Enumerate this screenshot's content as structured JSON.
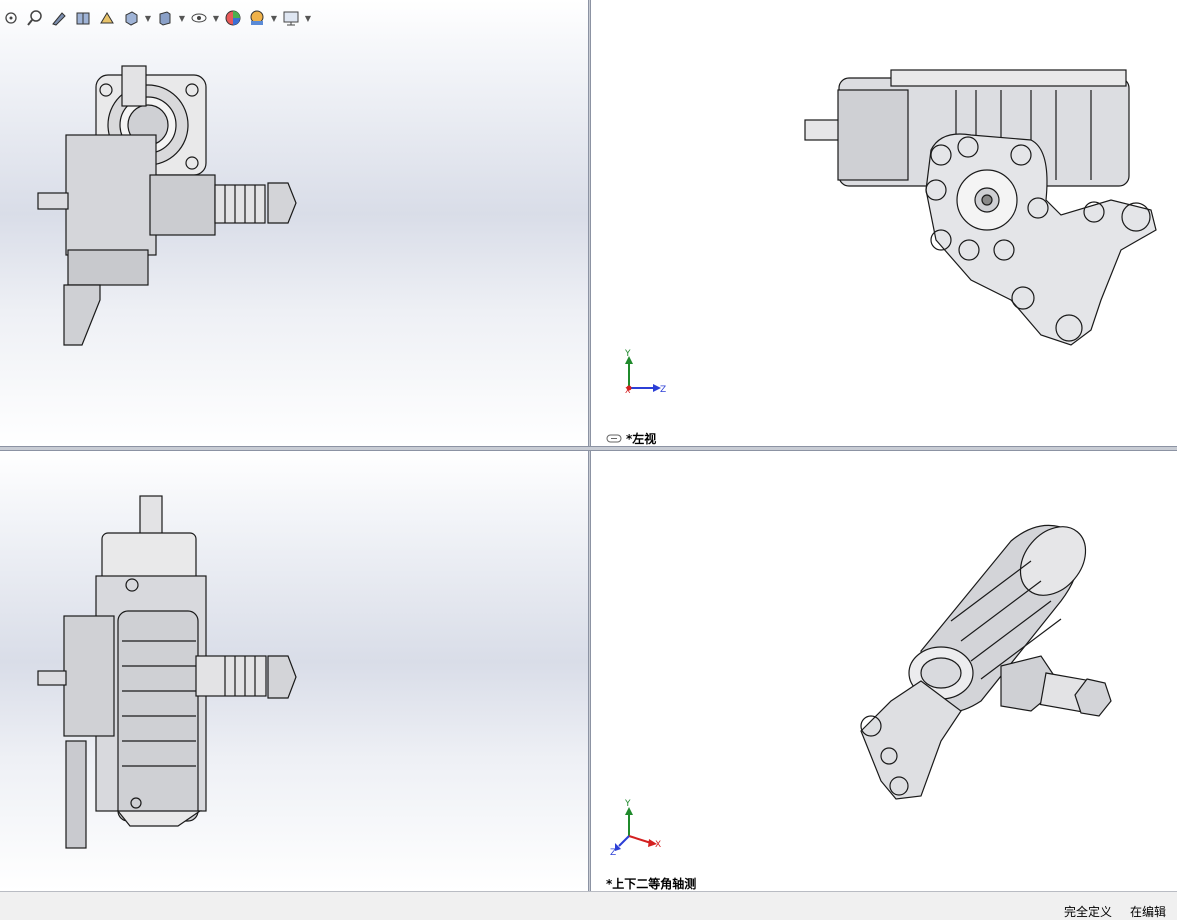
{
  "toolbar": {
    "items": [
      {
        "icon": "zoom-to-fit-icon"
      },
      {
        "icon": "zoom-area-icon"
      },
      {
        "icon": "previous-view-icon"
      },
      {
        "icon": "section-view-icon"
      },
      {
        "icon": "dynamic-annotation-icon"
      },
      {
        "icon": "view-orientation-icon",
        "dropdown": true
      },
      {
        "icon": "display-style-icon",
        "dropdown": true
      },
      {
        "icon": "hide-show-items-icon",
        "dropdown": true
      },
      {
        "icon": "edit-appearance-icon"
      },
      {
        "icon": "apply-scene-icon",
        "dropdown": true
      },
      {
        "icon": "view-settings-icon",
        "dropdown": true
      }
    ]
  },
  "viewports": {
    "top_right": {
      "label": "*左视",
      "link_icon": "link-views-icon"
    },
    "bottom_right": {
      "label": "*上下二等角轴测"
    }
  },
  "triad": {
    "y_label": "Y",
    "z_label": "Z",
    "x_label": "X"
  },
  "status": {
    "definition": "完全定义",
    "editing": "在编辑"
  },
  "colors": {
    "axis_y": "#1f8a2b",
    "axis_z": "#2c3fd6",
    "axis_x": "#d42020"
  }
}
